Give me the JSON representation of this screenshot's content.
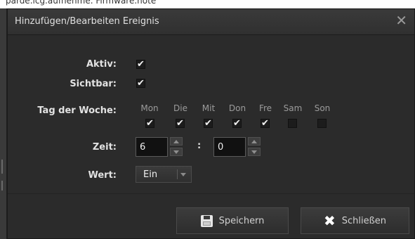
{
  "background_fragment": {
    "top_text": "parde.lcg.aufnehme. Firmware.note"
  },
  "dialog": {
    "title": "Hinzufügen/Bearbeiten Ereignis",
    "close_glyph": "✕"
  },
  "form": {
    "active": {
      "label": "Aktiv:",
      "checked": true
    },
    "visible": {
      "label": "Sichtbar:",
      "checked": true
    },
    "weekday": {
      "label": "Tag der Woche:",
      "days": [
        {
          "label": "Mon",
          "checked": true
        },
        {
          "label": "Die",
          "checked": true
        },
        {
          "label": "Mit",
          "checked": true
        },
        {
          "label": "Don",
          "checked": true
        },
        {
          "label": "Fre",
          "checked": true
        },
        {
          "label": "Sam",
          "checked": false
        },
        {
          "label": "Son",
          "checked": false
        }
      ]
    },
    "time": {
      "label": "Zeit:",
      "hours": "6",
      "separator": ":",
      "minutes": "0"
    },
    "value": {
      "label": "Wert:",
      "selected": "Ein"
    }
  },
  "buttons": {
    "save_label": "Speichern",
    "close_label": "Schließen"
  },
  "icons": {
    "save": "floppy-disk-icon",
    "close": "x-icon"
  },
  "colors": {
    "dialog_bg": "#2b2b2b",
    "title_bar": "#353535",
    "field_bg": "#111111",
    "text": "#e2e2e2",
    "muted": "#9b9b9b"
  }
}
